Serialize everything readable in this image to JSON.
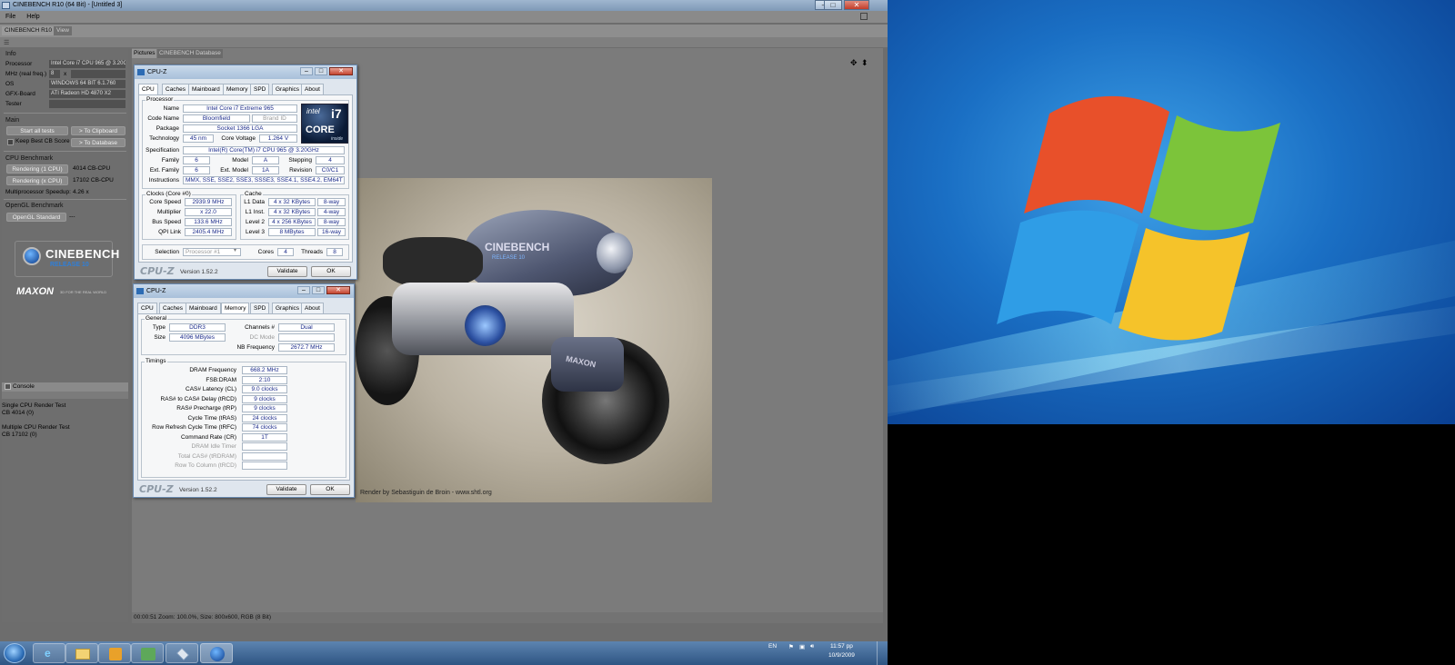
{
  "cinebench": {
    "title": "CINEBENCH R10 (64 Bit) - [Untitled 3]",
    "menu": [
      "File",
      "Help"
    ],
    "tabs": [
      "CINEBENCH R10",
      "View"
    ],
    "info": {
      "heading": "Info",
      "rows": [
        {
          "label": "Processor",
          "value": "Intel Core i7 CPU 965 @ 3.20GHz"
        },
        {
          "label": "MHz (real freq.)",
          "value": "8"
        },
        {
          "label": "OS",
          "value": "WINDOWS 64 BIT 6.1.760"
        },
        {
          "label": "GFX-Board",
          "value": "ATI Radeon HD 4870 X2"
        },
        {
          "label": "Tester",
          "value": ""
        }
      ],
      "mhz_x": "x"
    },
    "main": {
      "heading": "Main",
      "start_all": "Start all tests",
      "to_clipboard": "> To Clipboard",
      "keep_best": "Keep Best CB Score",
      "to_database": "> To Database"
    },
    "cpu_benchmark": {
      "heading": "CPU Benchmark",
      "render1": "Rendering (1 CPU)",
      "render1_score": "4014 CB-CPU",
      "renderx": "Rendering (x CPU)",
      "renderx_score": "17102 CB-CPU",
      "speedup_label": "Multiprocessor Speedup:",
      "speedup": "4.26 x"
    },
    "opengl": {
      "heading": "OpenGL Benchmark",
      "standard": "OpenGL Standard",
      "score": "---"
    },
    "logo": {
      "name": "CINEBENCH",
      "sub": "RELEASE 10",
      "maxon": "MAXON",
      "maxon_sub": "3D FOR THE REAL WORLD"
    },
    "console": {
      "heading": "Console",
      "lines": [
        "Single CPU Render Test",
        "CB 4014 (0)",
        "",
        "Multiple CPU Render Test",
        "CB 17102 (0)"
      ]
    },
    "picture_tabs": [
      "Pictures",
      "CINEBENCH Database"
    ],
    "render_credit": "Render by Sebastiguin de Broin - www.shtl.org",
    "bike_text": "CINEBENCH",
    "bike_sub": "RELEASE 10",
    "bike_maxon": "MAXON",
    "status": "00:00:51   Zoom: 100.0%, Size: 800x600, RGB (8 Bit)"
  },
  "cpuz1": {
    "title": "CPU-Z",
    "tabs": [
      "CPU",
      "Caches",
      "Mainboard",
      "Memory",
      "SPD",
      "Graphics",
      "About"
    ],
    "processor_group": "Processor",
    "name_label": "Name",
    "name": "Intel Core i7 Extreme 965",
    "codename_label": "Code Name",
    "codename": "Bloomfield",
    "brandid": "Brand ID",
    "package_label": "Package",
    "package": "Socket 1366 LGA",
    "tech_label": "Technology",
    "tech": "45 nm",
    "voltage_label": "Core Voltage",
    "voltage": "1.264 V",
    "spec_label": "Specification",
    "spec": "Intel(R) Core(TM) i7 CPU      965  @ 3.20GHz",
    "family_label": "Family",
    "family": "6",
    "model_label": "Model",
    "model": "A",
    "stepping_label": "Stepping",
    "stepping": "4",
    "extfamily_label": "Ext. Family",
    "extfamily": "6",
    "extmodel_label": "Ext. Model",
    "extmodel": "1A",
    "revision_label": "Revision",
    "revision": "C0/C1",
    "instr_label": "Instructions",
    "instr": "MMX, SSE, SSE2, SSE3, SSSE3, SSE4.1, SSE4.2, EM64T",
    "clocks_group": "Clocks (Core #0)",
    "corespeed_label": "Core Speed",
    "corespeed": "2939.9 MHz",
    "mult_label": "Multiplier",
    "mult": "x 22.0",
    "bus_label": "Bus Speed",
    "bus": "133.6 MHz",
    "qpi_label": "QPI Link",
    "qpi": "2405.4 MHz",
    "cache_group": "Cache",
    "l1d_label": "L1 Data",
    "l1d": "4 x 32 KBytes",
    "l1d_way": "8-way",
    "l1i_label": "L1 Inst.",
    "l1i": "4 x 32 KBytes",
    "l1i_way": "4-way",
    "l2_label": "Level 2",
    "l2": "4 x 256 KBytes",
    "l2_way": "8-way",
    "l3_label": "Level 3",
    "l3": "8 MBytes",
    "l3_way": "16-way",
    "selection_label": "Selection",
    "selection": "Processor #1",
    "cores_label": "Cores",
    "cores": "4",
    "threads_label": "Threads",
    "threads": "8",
    "logo": "CPU-Z",
    "version": "Version 1.52.2",
    "validate": "Validate",
    "ok": "OK",
    "intel_brand": "intel",
    "intel_core": "CORE",
    "intel_i7": "i7",
    "intel_inside": "inside"
  },
  "cpuz2": {
    "title": "CPU-Z",
    "tabs": [
      "CPU",
      "Caches",
      "Mainboard",
      "Memory",
      "SPD",
      "Graphics",
      "About"
    ],
    "general_group": "General",
    "type_label": "Type",
    "type": "DDR3",
    "channels_label": "Channels #",
    "channels": "Dual",
    "size_label": "Size",
    "size": "4096 MBytes",
    "dcmode_label": "DC Mode",
    "dcmode": "",
    "nbfreq_label": "NB Frequency",
    "nbfreq": "2672.7 MHz",
    "timings_group": "Timings",
    "timings": [
      {
        "label": "DRAM Frequency",
        "value": "668.2 MHz",
        "grey": false
      },
      {
        "label": "FSB:DRAM",
        "value": "2:10",
        "grey": false
      },
      {
        "label": "CAS# Latency (CL)",
        "value": "9.0 clocks",
        "grey": false
      },
      {
        "label": "RAS# to CAS# Delay (tRCD)",
        "value": "9 clocks",
        "grey": false
      },
      {
        "label": "RAS# Precharge (tRP)",
        "value": "9 clocks",
        "grey": false
      },
      {
        "label": "Cycle Time (tRAS)",
        "value": "24 clocks",
        "grey": false
      },
      {
        "label": "Row Refresh Cycle Time (tRFC)",
        "value": "74 clocks",
        "grey": false
      },
      {
        "label": "Command Rate (CR)",
        "value": "1T",
        "grey": false
      },
      {
        "label": "DRAM Idle Timer",
        "value": "",
        "grey": true
      },
      {
        "label": "Total CAS# (tRDRAM)",
        "value": "",
        "grey": true
      },
      {
        "label": "Row To Column (tRCD)",
        "value": "",
        "grey": true
      }
    ],
    "logo": "CPU-Z",
    "version": "Version 1.52.2",
    "validate": "Validate",
    "ok": "OK"
  },
  "taskbar": {
    "lang": "EN",
    "time": "11:57 pp",
    "date": "10/9/2009"
  },
  "colors": {
    "desktop_blue": "#1a6fc4",
    "flag_red": "#e8502a",
    "flag_green": "#7cc43a",
    "flag_blue": "#2f9de6",
    "flag_yellow": "#f5c32a"
  }
}
